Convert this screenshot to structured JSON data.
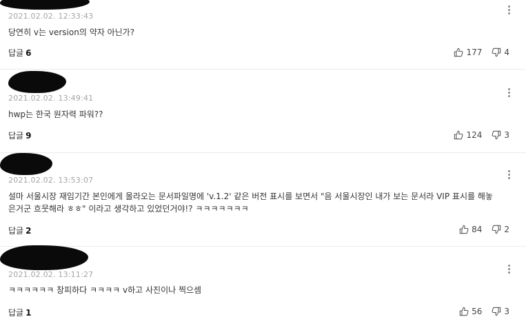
{
  "comments": [
    {
      "timestamp": "2021.02.02. 12:33:43",
      "text": "당연히 v는 version의 약자 아닌가?",
      "reply_label": "답글",
      "reply_count": "6",
      "likes": "177",
      "dislikes": "4"
    },
    {
      "timestamp": "2021.02.02. 13:49:41",
      "text": "hwp는 한국 원자력 파워??",
      "reply_label": "답글",
      "reply_count": "9",
      "likes": "124",
      "dislikes": "3"
    },
    {
      "timestamp": "2021.02.02. 13:53:07",
      "text": "설마 서울시장 재임기간 본인에게 올라오는 문서파일명에 'v.1.2' 같은 버전 표시를 보면서 \"음 서울시장인 내가 보는 문서라 VIP 표시를 해놓은거군 흐뭇해라 ㅎㅎ\" 이라고 생각하고 있었던거야!? ㅋㅋㅋㅋㅋㅋㅋ",
      "reply_label": "답글",
      "reply_count": "2",
      "likes": "84",
      "dislikes": "2"
    },
    {
      "timestamp": "2021.02.02. 13:11:27",
      "text": "ㅋㅋㅋㅋㅋㅋ 창피하다 ㅋㅋㅋㅋ v하고 사진이나 찍으셈",
      "reply_label": "답글",
      "reply_count": "1",
      "likes": "56",
      "dislikes": "3"
    }
  ],
  "icons": {
    "like": "thumbs-up-icon",
    "dislike": "thumbs-down-icon",
    "more": "more-vertical-icon"
  },
  "colors": {
    "timestamp": "#a4a4a4",
    "redaction": "#0a0a0a",
    "divider": "#ececec"
  }
}
